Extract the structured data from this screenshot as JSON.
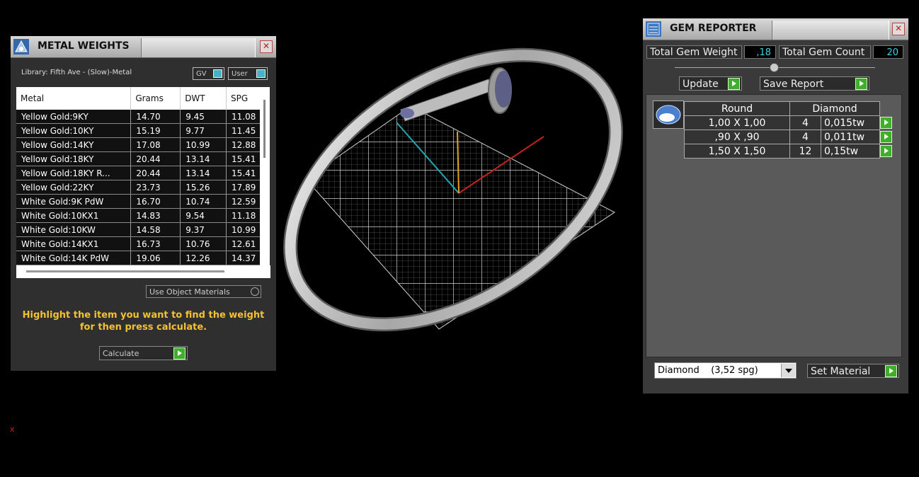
{
  "metal_panel": {
    "title": "METAL WEIGHTS",
    "library_label": "Library: Fifth Ave - (Slow)-Metal",
    "toggle_gv": "GV",
    "toggle_user": "User",
    "columns": [
      "Metal",
      "Grams",
      "DWT",
      "SPG"
    ],
    "rows": [
      [
        "Yellow Gold:9KY",
        "14.70",
        "9.45",
        "11.08"
      ],
      [
        "Yellow Gold:10KY",
        "15.19",
        "9.77",
        "11.45"
      ],
      [
        "Yellow Gold:14KY",
        "17.08",
        "10.99",
        "12.88"
      ],
      [
        "Yellow Gold:18KY",
        "20.44",
        "13.14",
        "15.41"
      ],
      [
        "Yellow Gold:18KY R...",
        "20.44",
        "13.14",
        "15.41"
      ],
      [
        "Yellow Gold:22KY",
        "23.73",
        "15.26",
        "17.89"
      ],
      [
        "White Gold:9K PdW",
        "16.70",
        "10.74",
        "12.59"
      ],
      [
        "White Gold:10KX1",
        "14.83",
        "9.54",
        "11.18"
      ],
      [
        "White Gold:10KW",
        "14.58",
        "9.37",
        "10.99"
      ],
      [
        "White Gold:14KX1",
        "16.73",
        "10.76",
        "12.61"
      ],
      [
        "White Gold:14K PdW",
        "19.06",
        "12.26",
        "14.37"
      ]
    ],
    "object_materials_label": "Use Object Materials",
    "hint": "Highlight the item you want to find the weight for then press calculate.",
    "calculate_label": "Calculate"
  },
  "gem_panel": {
    "title": "GEM REPORTER",
    "total_weight_label": "Total Gem Weight",
    "total_weight_value": ",18",
    "total_count_label": "Total Gem Count",
    "total_count_value": "20",
    "update_label": "Update",
    "save_report_label": "Save Report",
    "header": [
      "Round",
      "Diamond"
    ],
    "rows": [
      [
        "1,00 X 1,00",
        "4",
        "0,015tw"
      ],
      [
        ",90 X ,90",
        "4",
        "0,011tw"
      ],
      [
        "1,50 X 1,50",
        "12",
        "0,15tw"
      ]
    ],
    "material_select": "Diamond    (3,52 spg)",
    "set_material_label": "Set Material"
  },
  "viewport": {
    "axis_label": "x"
  },
  "colors": {
    "accent_green": "#3fae2a",
    "value_cyan": "#3fd0e6",
    "hint_yellow": "#f1c232"
  }
}
